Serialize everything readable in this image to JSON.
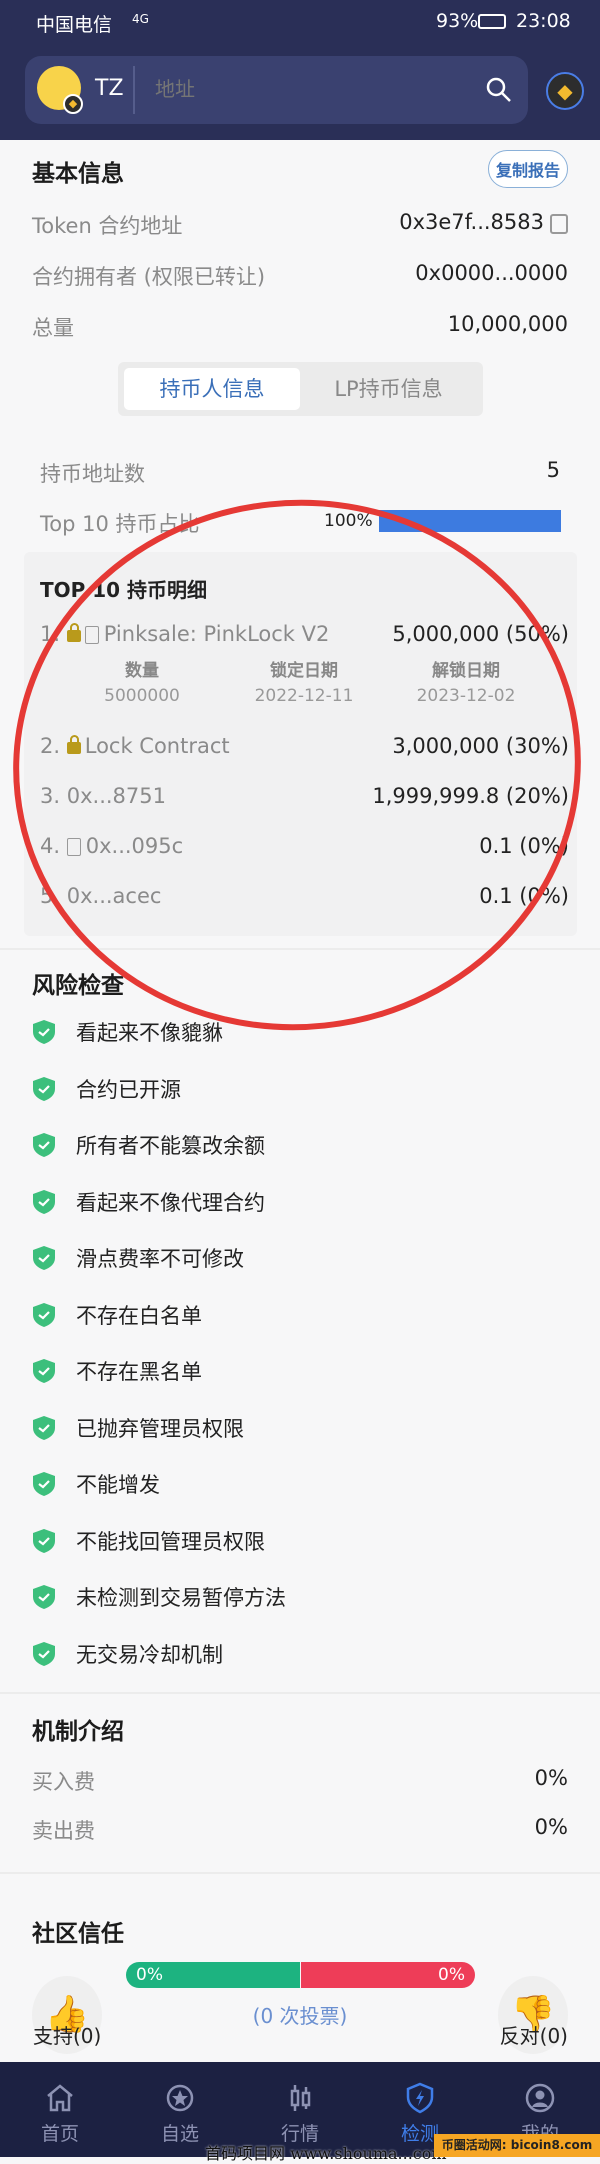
{
  "status_bar": {
    "carrier": "中国电信",
    "network": "4G",
    "battery": "93%",
    "time": "23:08"
  },
  "header": {
    "token_symbol": "TZ",
    "search_placeholder": "地址",
    "chain": "BNB Chain"
  },
  "basic_info": {
    "title": "基本信息",
    "copy_report": "复制报告",
    "rows": [
      {
        "label": "Token 合约地址",
        "value": "0x3e7f...8583"
      },
      {
        "label": "合约拥有者 (权限已转让)",
        "value": "0x0000...0000"
      },
      {
        "label": "总量",
        "value": "10,000,000"
      }
    ]
  },
  "tabs": [
    {
      "label": "持币人信息",
      "active": true
    },
    {
      "label": "LP持币信息",
      "active": false
    }
  ],
  "holders": {
    "count_label": "持币地址数",
    "count": "5",
    "top10_label": "Top 10 持币占比",
    "top10_pct": "100%",
    "top10_fraction": 1.0,
    "bar_color": "#3d7be0"
  },
  "top10": {
    "title": "TOP 10 持币明细",
    "rows": [
      {
        "rank": "1.",
        "lock": true,
        "contract": true,
        "name": "Pinksale: PinkLock V2",
        "amount": "5,000,000 (50%)",
        "lock_detail": {
          "labels": [
            "数量",
            "锁定日期",
            "解锁日期"
          ],
          "values": [
            "5000000",
            "2022-12-11",
            "2023-12-02"
          ]
        }
      },
      {
        "rank": "2.",
        "lock": true,
        "contract": false,
        "name": "Lock Contract",
        "amount": "3,000,000 (30%)"
      },
      {
        "rank": "3.",
        "lock": false,
        "contract": false,
        "name": "0x...8751",
        "amount": "1,999,999.8 (20%)"
      },
      {
        "rank": "4.",
        "lock": false,
        "contract": true,
        "name": "0x...095c",
        "amount": "0.1 (0%)"
      },
      {
        "rank": "5.",
        "lock": false,
        "contract": false,
        "name": "0x...acec",
        "amount": "0.1 (0%)"
      }
    ]
  },
  "risk": {
    "title": "风险检查",
    "items": [
      "看起来不像貔貅",
      "合约已开源",
      "所有者不能篡改余额",
      "看起来不像代理合约",
      "滑点费率不可修改",
      "不存在白名单",
      "不存在黑名单",
      "已抛弃管理员权限",
      "不能增发",
      "不能找回管理员权限",
      "未检测到交易暂停方法",
      "无交易冷却机制"
    ],
    "ok_color": "#3cbf7c"
  },
  "mechanism": {
    "title": "机制介绍",
    "rows": [
      {
        "label": "买入费",
        "value": "0%"
      },
      {
        "label": "卖出费",
        "value": "0%"
      }
    ]
  },
  "community": {
    "title": "社区信任",
    "support_pct": "0%",
    "oppose_pct": "0%",
    "votes": "(0 次投票)",
    "support": "支持(0)",
    "oppose": "反对(0)",
    "support_color": "#1db380",
    "oppose_color": "#ee3d58"
  },
  "nav": [
    {
      "label": "首页",
      "icon": "home-icon"
    },
    {
      "label": "自选",
      "icon": "star-icon"
    },
    {
      "label": "行情",
      "icon": "candlestick-icon"
    },
    {
      "label": "检测",
      "icon": "shield-bolt-icon",
      "active": true
    },
    {
      "label": "我的",
      "icon": "user-icon"
    }
  ],
  "watermark": {
    "text": "首码项目网 www.shouma...com",
    "badge": "币圈活动网: bicoin8.com"
  },
  "annotation_color": "#e53935"
}
